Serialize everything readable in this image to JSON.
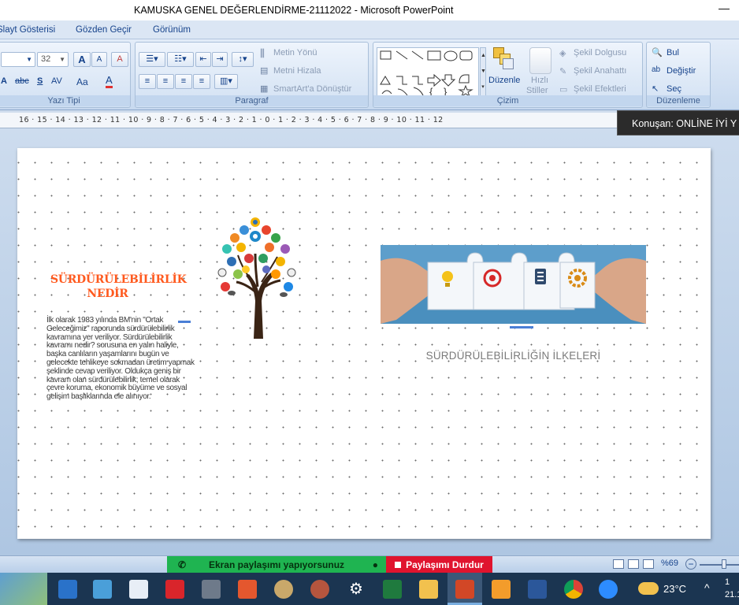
{
  "window": {
    "title": "KAMUSKA GENEL DEĞERLENDİRME-21112022 - Microsoft PowerPoint",
    "minimize": "—"
  },
  "ribbon_tabs": [
    "Slayt Gösterisi",
    "Gözden Geçir",
    "Görünüm"
  ],
  "font_group": {
    "label": "Yazı Tipi",
    "font_size": "32",
    "grow": "A",
    "shrink": "A",
    "clear": "A",
    "strike": "abc",
    "shadow": "S",
    "spacing": "AV",
    "case": "Aa",
    "color": "A"
  },
  "paragraph_group": {
    "label": "Paragraf",
    "text_direction": "Metin Yönü",
    "align_text": "Metni Hizala",
    "smartart": "SmartArt'a Dönüştür"
  },
  "drawing_group": {
    "label": "Çizim",
    "arrange": "Düzenle",
    "quick_styles_1": "Hızlı",
    "quick_styles_2": "Stiller",
    "shape_fill": "Şekil Dolgusu",
    "shape_outline": "Şekil Anahattı",
    "shape_effects": "Şekil Efektleri"
  },
  "editing_group": {
    "label": "Düzenleme",
    "find": "Bul",
    "replace": "Değiştir",
    "select": "Seç"
  },
  "ruler": {
    "text": "16 · 15 · 14 · 13 · 12 · 11 · 10 · 9 · 8 · 7 · 6 · 5 · 4 · 3 · 2 · 1 · 0 · 1 · 2 · 3 · 4 · 5 · 6 · 7 · 8 · 9 · 10 · 11 · 12"
  },
  "speaker_tooltip": "Konuşan: ONLİNE İYİ Y",
  "slide": {
    "title": "SÜRDÜRÜLEBİLİRLİK NEDİR",
    "body": "İlk olarak 1983 yılında BM'nin \"Ortak Geleceğimiz\" raporunda sürdürülebilirlik kavramına yer veriliyor. Sürdürülebilirlik kavramı nedir? sorusuna en yalın haliyle, başka canlıların yaşamlarını bugün ve gelecekte tehlikeye sokmadan üretim yapmak şeklinde cevap veriliyor. Oldukça geniş bir kavram olan sürdürülebilirlik; temel olarak çevre koruma, ekonomik büyüme ve sosyal gelişim başlıklarında ele alınıyor.",
    "subtitle": "SÜRDÜRÜLEBİLİRLİĞİN İLKELERİ"
  },
  "status": {
    "screen_share": "Ekran paylaşımı yapıyorsunuz",
    "stop_share": "Paylaşımı Durdur",
    "zoom": "%69"
  },
  "taskbar": {
    "temperature": "23°C",
    "time": "1",
    "date": "21.1"
  },
  "colors": {
    "title_orange": "#ff5a1f",
    "share_green": "#1fb451",
    "stop_red": "#e0142e",
    "taskbar": "#1b3551"
  }
}
